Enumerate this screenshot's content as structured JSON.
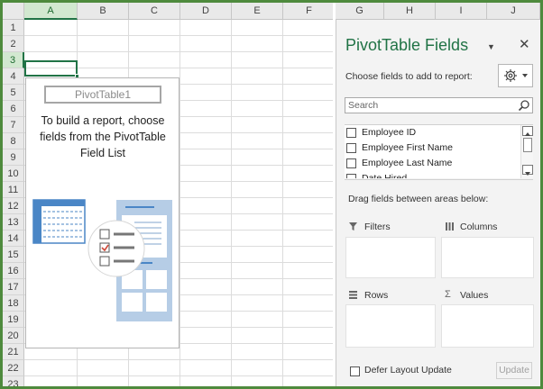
{
  "sheet": {
    "columns": [
      "A",
      "B",
      "C",
      "D",
      "E",
      "F",
      "G",
      "H",
      "I",
      "J"
    ],
    "rows": [
      "1",
      "2",
      "3",
      "4",
      "5",
      "6",
      "7",
      "8",
      "9",
      "10",
      "11",
      "12",
      "13",
      "14",
      "15",
      "16",
      "17",
      "18",
      "19",
      "20",
      "21",
      "22",
      "23"
    ],
    "active_column": "A",
    "active_row": "3"
  },
  "pivot_placeholder": {
    "name": "PivotTable1",
    "instruction_line1": "To build a report, choose",
    "instruction_line2": "fields from the PivotTable",
    "instruction_line3": "Field List"
  },
  "field_pane": {
    "title": "PivotTable Fields",
    "choose_label": "Choose fields to add to report:",
    "search_placeholder": "Search",
    "fields": [
      "Employee ID",
      "Employee First Name",
      "Employee Last Name",
      "Date Hired"
    ],
    "drag_label": "Drag fields between areas below:",
    "areas": {
      "filters": "Filters",
      "columns": "Columns",
      "rows": "Rows",
      "values": "Values"
    },
    "defer_label": "Defer Layout Update",
    "update_label": "Update"
  },
  "colors": {
    "accent": "#217346",
    "frame": "#4e8a3d",
    "illustration_blue": "#4a86c6"
  }
}
